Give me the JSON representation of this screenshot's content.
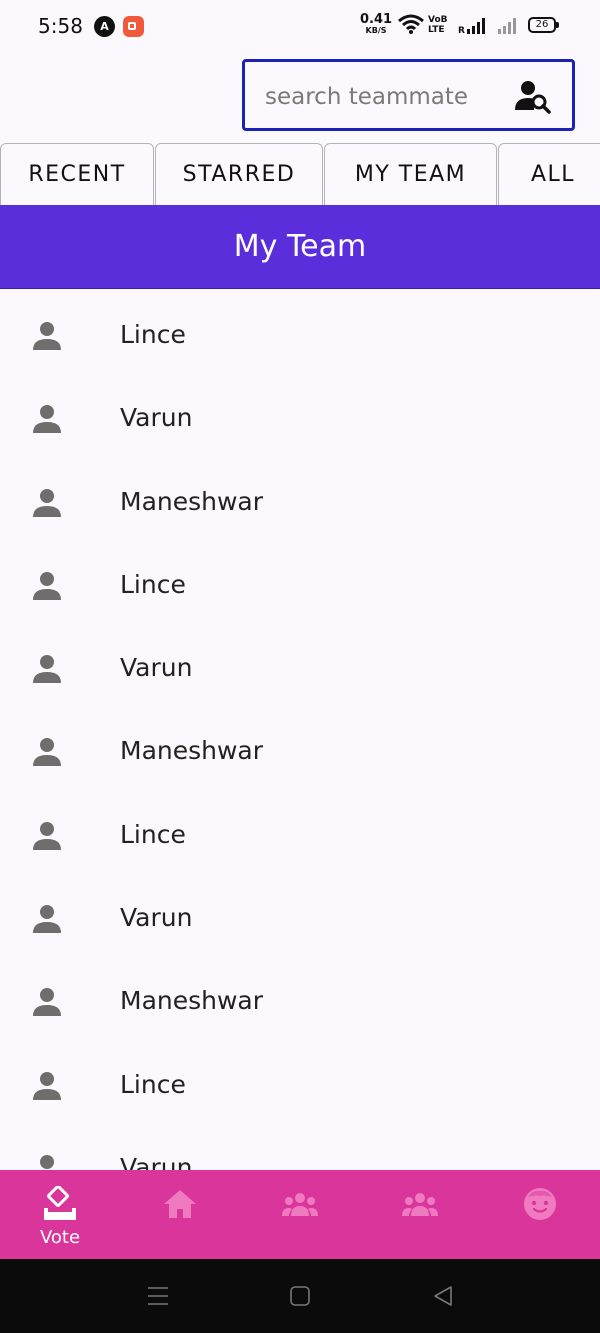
{
  "status_bar": {
    "time": "5:58",
    "app_icon_1": "A",
    "speed_value": "0.41",
    "speed_unit": "KB/S",
    "volte_top": "VoB",
    "volte_bottom": "LTE",
    "battery": "26"
  },
  "search": {
    "placeholder": "search teammate",
    "value": "",
    "icon": "person-search-icon",
    "border_color": "#1c22b8"
  },
  "tabs": [
    {
      "label": "RECENT"
    },
    {
      "label": "STARRED"
    },
    {
      "label": "MY TEAM"
    },
    {
      "label": "ALL"
    }
  ],
  "header": {
    "title": "My Team",
    "background": "#5a2edb"
  },
  "team_list": [
    {
      "name": "Lince"
    },
    {
      "name": "Varun"
    },
    {
      "name": "Maneshwar"
    },
    {
      "name": "Lince"
    },
    {
      "name": "Varun"
    },
    {
      "name": "Maneshwar"
    },
    {
      "name": "Lince"
    },
    {
      "name": "Varun"
    },
    {
      "name": "Maneshwar"
    },
    {
      "name": "Lince"
    },
    {
      "name": "Varun"
    }
  ],
  "bottom_nav": {
    "background": "#d9359a",
    "items": [
      {
        "label": "Vote",
        "icon": "vote-icon",
        "active": true
      },
      {
        "label": "",
        "icon": "home-icon",
        "active": false
      },
      {
        "label": "",
        "icon": "group-icon",
        "active": false
      },
      {
        "label": "",
        "icon": "group-icon",
        "active": false
      },
      {
        "label": "",
        "icon": "face-icon",
        "active": false
      }
    ]
  },
  "system_nav": {
    "items": [
      "menu-icon",
      "home-square-icon",
      "back-triangle-icon"
    ]
  }
}
